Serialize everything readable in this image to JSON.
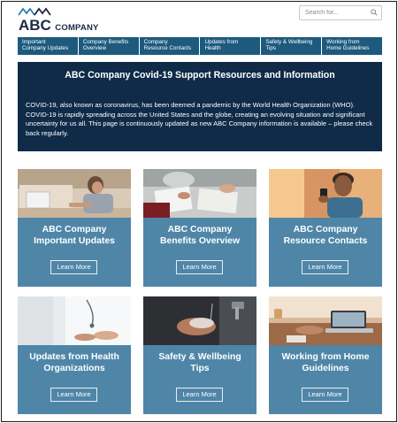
{
  "header": {
    "logo_abc": "ABC",
    "logo_company": "COMPANY",
    "search_placeholder": "Search for..."
  },
  "nav": {
    "items": [
      {
        "line1": "Important",
        "line2": "Company Updates"
      },
      {
        "line1": "Company Benefits",
        "line2": "Overview"
      },
      {
        "line1": "Company",
        "line2": "Resource Contacts"
      },
      {
        "line1": "Updates from",
        "line2": "Health"
      },
      {
        "line1": "Safety & Wellbeing",
        "line2": "Tips"
      },
      {
        "line1": "Working from",
        "line2": "Home Guidelines"
      }
    ]
  },
  "hero": {
    "title": "ABC Company Covid-19 Support Resources and Information",
    "body_lines": [
      "COVID-19, also known as coronavirus, has been deemed a pandemic by the World Health Organization (WHO).",
      "COVID-19 is rapidly spreading across the United States and the globe, creating an evolving situation and significant",
      "uncertainty for us all. This page is continuously updated as new ABC Company information is available – please check",
      "back regularly."
    ]
  },
  "cards": [
    {
      "line1": "ABC Company",
      "line2": "Important Updates",
      "button": "Learn More"
    },
    {
      "line1": "ABC Company",
      "line2": "Benefits Overview",
      "button": "Learn More"
    },
    {
      "line1": "ABC Company",
      "line2": "Resource Contacts",
      "button": "Learn More"
    },
    {
      "line1": "Updates from Health",
      "line2": "Organizations",
      "button": "Learn More"
    },
    {
      "line1": "Safety & Wellbeing",
      "line2": "Tips",
      "button": "Learn More"
    },
    {
      "line1": "Working from Home",
      "line2": "Guidelines",
      "button": "Learn More"
    }
  ],
  "colors": {
    "nav_bg": "#1d5a7e",
    "hero_bg": "#0f2b48",
    "card_bg": "#4f86a8",
    "logo_text": "#1b2a45",
    "logo_peaks": "#2f7fb0"
  }
}
